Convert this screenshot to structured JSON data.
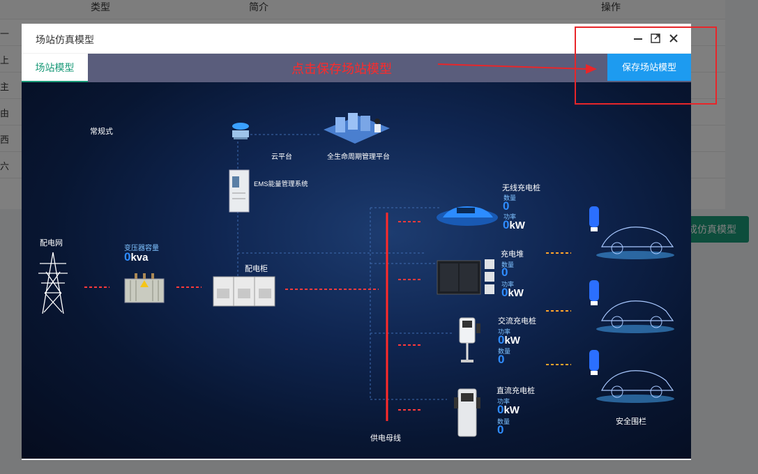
{
  "background": {
    "columns": [
      "类型",
      "简介",
      "操作"
    ],
    "row_fragments": [
      "一",
      "上",
      "主",
      "由",
      "西",
      "六"
    ],
    "green_button": "成仿真模型"
  },
  "modal": {
    "title": "场站仿真模型",
    "tab": "场站模型",
    "hint": "点击保存场站模型",
    "save_button": "保存场站模型"
  },
  "diagram": {
    "mode": "常规式",
    "cloud": "云平台",
    "lifecycle": "全生命周期管理平台",
    "ems": "EMS能量管理系统",
    "grid": "配电网",
    "transformer": {
      "label": "变压器容量",
      "value": "0",
      "unit": "kva"
    },
    "cabinet": "配电柜",
    "busbar": "供电母线",
    "wireless": {
      "name": "无线充电桩",
      "l1": "数量",
      "v1": "0",
      "l2": "功率",
      "v2": "0",
      "u2": "kW"
    },
    "stack": {
      "name": "充电堆",
      "l1": "数量",
      "v1": "0",
      "l2": "功率",
      "v2": "0",
      "u2": "kW"
    },
    "ac": {
      "name": "交流充电桩",
      "l1": "功率",
      "v1": "0",
      "u1": "kW",
      "l2": "数量",
      "v2": "0"
    },
    "dc": {
      "name": "直流充电桩",
      "l1": "功率",
      "v1": "0",
      "u1": "kW",
      "l2": "数量",
      "v2": "0"
    },
    "fence": "安全围栏"
  }
}
